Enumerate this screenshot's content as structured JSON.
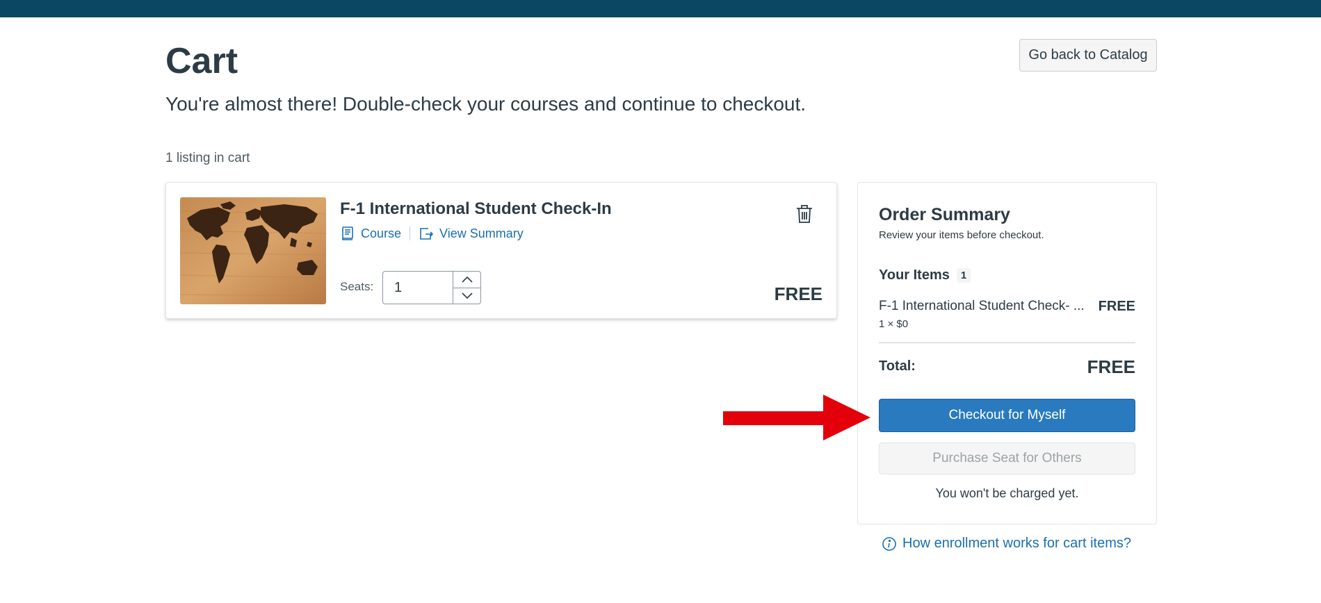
{
  "page": {
    "title": "Cart",
    "back_label": "Go back to Catalog",
    "subtitle": "You're almost there! Double-check your courses and continue to checkout.",
    "listing_count": "1 listing in cart"
  },
  "cart_item": {
    "title": "F-1 International Student Check-In",
    "type_label": "Course",
    "view_summary_label": "View Summary",
    "seats_label": "Seats:",
    "seats_value": "1",
    "price": "FREE",
    "image_icon": "world-map-image"
  },
  "summary": {
    "title": "Order Summary",
    "subtitle": "Review your items before checkout.",
    "your_items_label": "Your Items",
    "items_count": "1",
    "line_name": "F-1 International Student Check- ...",
    "line_price": "FREE",
    "line_qty": "1 × $0",
    "total_label": "Total:",
    "total_value": "FREE",
    "checkout_label": "Checkout for Myself",
    "others_label": "Purchase Seat for Others",
    "charged_note": "You won't be charged yet."
  },
  "help_link": "How enrollment works for cart items?",
  "colors": {
    "topbar": "#0b4662",
    "primary": "#2a7abf",
    "link": "#1a6fb0",
    "text": "#2d3b45",
    "annotation_arrow": "#e3000b"
  }
}
